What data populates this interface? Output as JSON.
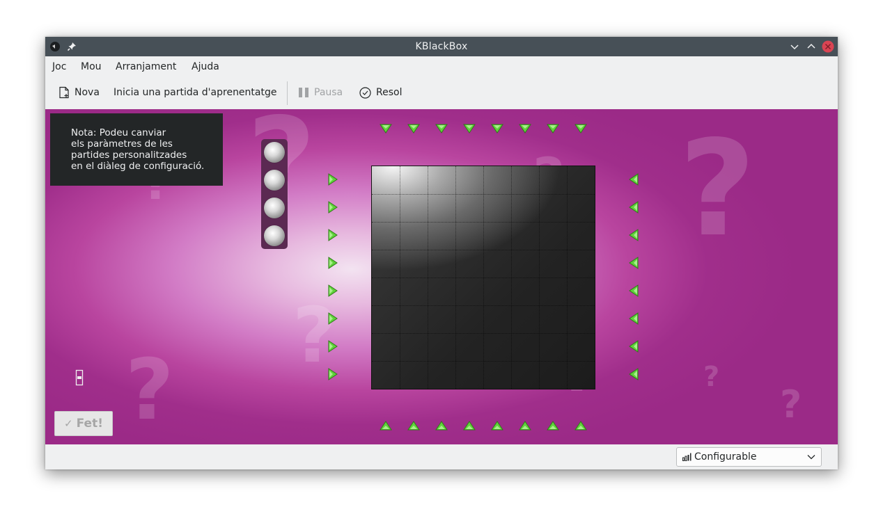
{
  "window": {
    "title": "KBlackBox"
  },
  "menu": {
    "items": [
      "Joc",
      "Mou",
      "Arranjament",
      "Ajuda"
    ]
  },
  "toolbar": {
    "new_label": "Nova",
    "tutorial_label": "Inicia una partida d'aprenentatge",
    "pause_label": "Pausa",
    "solve_label": "Resol"
  },
  "note": {
    "lines": [
      "Nota: Podeu canviar",
      "els paràmetres de les",
      "partides personalitzades",
      "en el diàleg de configuració."
    ]
  },
  "game": {
    "balls_remaining": 4,
    "grid_columns": 8,
    "grid_rows": 8,
    "laser_count_per_side": 8
  },
  "done_button": {
    "label": "Fet!"
  },
  "difficulty": {
    "selected": "Configurable"
  },
  "colors": {
    "board_background": "#9b2a87",
    "laser_green": "#5fd23a",
    "titlebar": "#475057",
    "close_button": "#da4453"
  },
  "icons": [
    "app-icon",
    "pin-icon",
    "minimize-icon",
    "maximize-icon",
    "close-icon",
    "new-document-icon",
    "pause-icon",
    "check-circle-icon",
    "ball-icon",
    "laser-arrow-icon",
    "marker-icon",
    "checkmark-icon",
    "signal-bars-icon",
    "chevron-down-icon"
  ]
}
